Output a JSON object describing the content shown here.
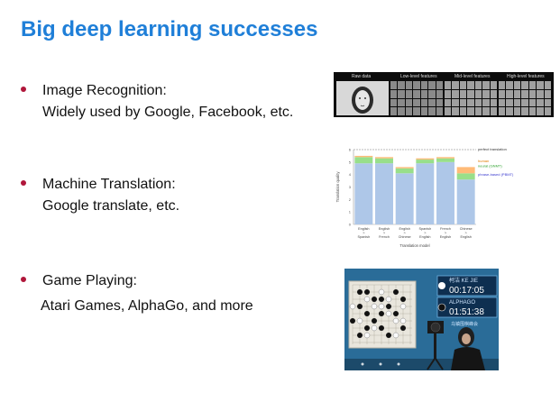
{
  "slide": {
    "title": "Big deep learning successes",
    "bullets": [
      {
        "heading": "Image Recognition:",
        "sub": "Widely used by Google, Facebook, etc."
      },
      {
        "heading": "Machine Translation:",
        "sub": "Google translate, etc."
      },
      {
        "heading": "Game Playing:",
        "sub": "Atari Games, AlphaGo, and more"
      }
    ]
  },
  "feature_panel": {
    "labels": [
      "Raw data",
      "Low-level features",
      "Mid-level features",
      "High-level features"
    ]
  },
  "go_overlay": {
    "player1_name": "柯洁 KE JIE",
    "player1_time": "00:17:05",
    "player2_name": "ALPHAGO",
    "player2_time": "01:51:38",
    "footer": "乌镇围棋峰会"
  },
  "chart_data": {
    "type": "bar",
    "categories": [
      "English\n>\nSpanish",
      "English\n>\nFrench",
      "English\n>\nChinese",
      "Spanish\n>\nEnglish",
      "French\n>\nEnglish",
      "Chinese\n>\nEnglish"
    ],
    "series": [
      {
        "name": "phrase-based (PBMT)",
        "values": [
          4.9,
          4.9,
          4.1,
          4.9,
          5.0,
          3.6
        ]
      },
      {
        "name": "neural (GNMT)",
        "values": [
          5.4,
          5.3,
          4.5,
          5.2,
          5.3,
          4.1
        ]
      },
      {
        "name": "human",
        "values": [
          5.5,
          5.4,
          4.6,
          5.3,
          5.4,
          4.6
        ]
      }
    ],
    "reference_line": {
      "label": "perfect translation",
      "value": 6
    },
    "yticks": [
      "0",
      "1",
      "2",
      "3",
      "4",
      "5",
      "6"
    ],
    "ylim": [
      0,
      6
    ],
    "xlabel": "Translation model",
    "ylabel": "Translation quality",
    "colors": {
      "pbmt": "#aec7e8",
      "gnmt": "#98df8a",
      "human": "#ffbb78"
    }
  }
}
